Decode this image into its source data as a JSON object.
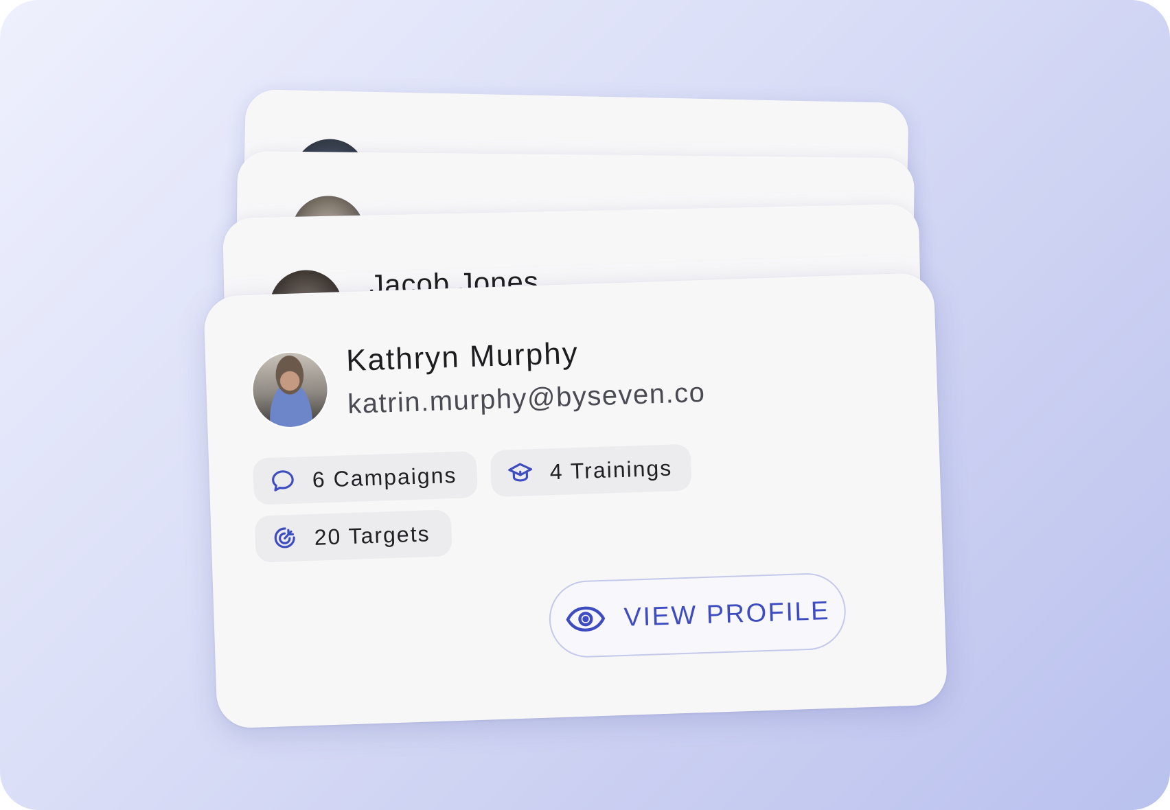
{
  "colors": {
    "accent": "#3e4cc2",
    "card_bg": "#f8f7f8",
    "chip_bg": "#ecebee",
    "button_border": "#c4c8ea"
  },
  "stacked_cards": [
    {
      "name": "",
      "avatar_icon": "user-photo"
    },
    {
      "name": "",
      "avatar_icon": "user-photo"
    },
    {
      "name": "Jacob Jones",
      "avatar_icon": "user-photo"
    }
  ],
  "profile_card": {
    "avatar_icon": "user-photo",
    "name": "Kathryn Murphy",
    "email": "katrin.murphy@byseven.co",
    "stats": [
      {
        "icon": "chat-bubble-icon",
        "label": "6 Campaigns"
      },
      {
        "icon": "graduation-cap-icon",
        "label": "4 Trainings"
      },
      {
        "icon": "target-icon",
        "label": "20 Targets"
      }
    ],
    "view_profile": {
      "icon": "eye-icon",
      "label": "VIEW PROFILE"
    }
  }
}
